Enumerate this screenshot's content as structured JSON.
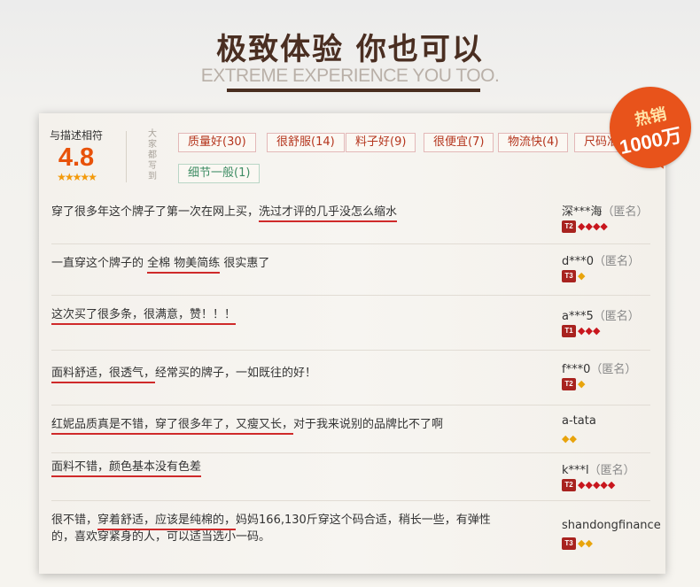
{
  "header": {
    "title": "极致体验 你也可以",
    "subtitle": "EXTREME EXPERIENCE YOU TOO."
  },
  "rating": {
    "label": "与描述相符",
    "score": "4.8",
    "stars": "★★★★★"
  },
  "tags_label": "大家都写到",
  "tags": [
    {
      "label": "质量好(30)",
      "color": "red"
    },
    {
      "label": "很舒服(14)",
      "color": "red"
    },
    {
      "label": "料子好(9)",
      "color": "red"
    },
    {
      "label": "很便宜(7)",
      "color": "red"
    },
    {
      "label": "物流快(4)",
      "color": "red"
    },
    {
      "label": "尺码准(3)",
      "color": "red"
    },
    {
      "label": "细节一般(1)",
      "color": "green"
    }
  ],
  "badge": {
    "line1": "热销",
    "line2": "1000万"
  },
  "reviews": [
    {
      "parts": [
        {
          "t": "穿了很多年这个牌子了第一次在网上买，"
        },
        {
          "t": "洗过才评的几乎没怎么缩水",
          "u": true
        }
      ],
      "user": "深***海",
      "anon": "（匿名）",
      "level": "T2",
      "gems": "red",
      "gem_count": 4
    },
    {
      "parts": [
        {
          "t": "一直穿这个牌子的 "
        },
        {
          "t": "全棉 物美简练",
          "u": true
        },
        {
          "t": " 很实惠了"
        }
      ],
      "user": "d***0",
      "anon": "（匿名）",
      "level": "T3",
      "gems": "gold",
      "gem_count": 1
    },
    {
      "parts": [
        {
          "t": "这次买了很多条，很满意，赞！！！",
          "u": true
        }
      ],
      "user": "a***5",
      "anon": "（匿名）",
      "level": "T1",
      "gems": "red",
      "gem_count": 3
    },
    {
      "parts": [
        {
          "t": "面料舒适，很透气，",
          "u": true
        },
        {
          "t": "经常买的牌子，一如既往的好！"
        }
      ],
      "user": "f***0",
      "anon": "（匿名）",
      "level": "T2",
      "gems": "gold",
      "gem_count": 1
    },
    {
      "parts": [
        {
          "t": "红妮品质真是不错，穿了很多年了，又瘦又长，",
          "u": true
        },
        {
          "t": "对于我来说别的品牌比不了啊"
        }
      ],
      "user": "a-tata",
      "anon": "",
      "level": "",
      "gems": "gold",
      "gem_count": 2
    },
    {
      "parts": [
        {
          "t": "面料不错，颜色基本没有色差",
          "u": true
        }
      ],
      "user": "k***l",
      "anon": "（匿名）",
      "level": "T2",
      "gems": "red",
      "gem_count": 5
    },
    {
      "parts": [
        {
          "t": "很不错，"
        },
        {
          "t": "穿着舒适，应该是纯棉的，",
          "u": true
        },
        {
          "t": "妈妈166,130斤穿这个码合适，稍长一些，有弹性的，喜欢穿紧身的人，可以适当选小一码。"
        }
      ],
      "user": "shandongfinance",
      "anon": "",
      "level": "T3",
      "gems": "gold",
      "gem_count": 2
    }
  ],
  "colors": {
    "accent": "#e8520a",
    "brand_dark": "#4a2e21",
    "underline": "#cf2a2a"
  }
}
